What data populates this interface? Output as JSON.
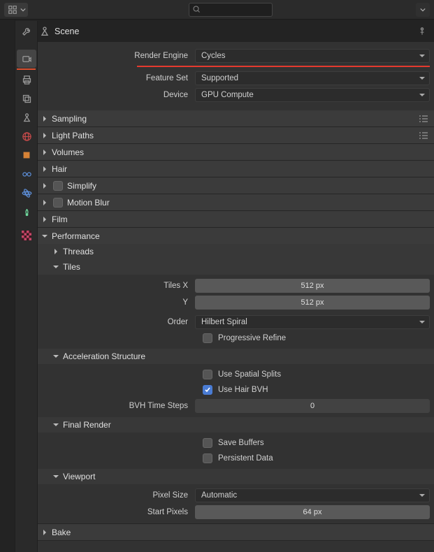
{
  "header": {
    "scene_label": "Scene",
    "search_placeholder": ""
  },
  "render": {
    "engine_label": "Render Engine",
    "engine_value": "Cycles",
    "feature_set_label": "Feature Set",
    "feature_set_value": "Supported",
    "device_label": "Device",
    "device_value": "GPU Compute"
  },
  "panels": {
    "sampling": "Sampling",
    "light_paths": "Light Paths",
    "volumes": "Volumes",
    "hair": "Hair",
    "simplify": "Simplify",
    "motion_blur": "Motion Blur",
    "film": "Film",
    "performance": "Performance",
    "threads": "Threads",
    "tiles": {
      "title": "Tiles",
      "tiles_x_label": "Tiles X",
      "tiles_x_value": "512 px",
      "tiles_y_label": "Y",
      "tiles_y_value": "512 px",
      "order_label": "Order",
      "order_value": "Hilbert Spiral",
      "progressive_refine": "Progressive Refine"
    },
    "accel": {
      "title": "Acceleration Structure",
      "spatial_splits": "Use Spatial Splits",
      "hair_bvh": "Use Hair BVH",
      "bvh_time_label": "BVH Time Steps",
      "bvh_time_value": "0"
    },
    "final_render": {
      "title": "Final Render",
      "save_buffers": "Save Buffers",
      "persistent_data": "Persistent Data"
    },
    "viewport": {
      "title": "Viewport",
      "pixel_size_label": "Pixel Size",
      "pixel_size_value": "Automatic",
      "start_pixels_label": "Start Pixels",
      "start_pixels_value": "64 px"
    },
    "bake": "Bake"
  }
}
